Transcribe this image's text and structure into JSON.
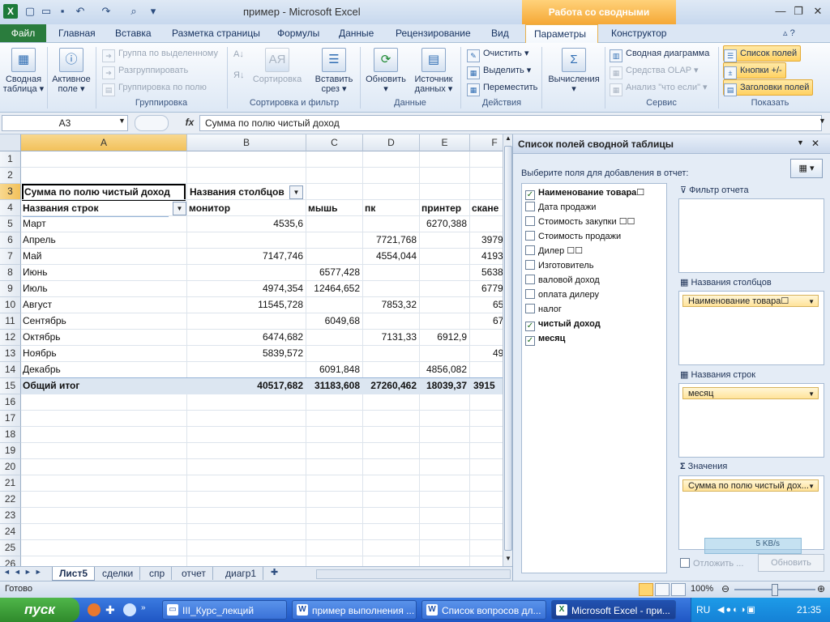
{
  "window": {
    "title": "пример  -  Microsoft Excel",
    "context_tab": "Работа со сводными таблицами",
    "app_icon": "X"
  },
  "tabs": [
    "Файл",
    "Главная",
    "Вставка",
    "Разметка страницы",
    "Формулы",
    "Данные",
    "Рецензирование",
    "Вид",
    "Параметры",
    "Конструктор"
  ],
  "ribbon": {
    "pivot_table": "Сводная\nтаблица ▾",
    "active_field": "Активное\nполе ▾",
    "group_selection": "Группа по выделенному",
    "ungroup": "Разгруппировать",
    "group_field": "Группировка по полю",
    "group_label": "Группировка",
    "sort": "Сортировка",
    "insert_slicer": "Вставить\nсрез ▾",
    "sort_label": "Сортировка и фильтр",
    "refresh": "Обновить\n▾",
    "data_source": "Источник\nданных ▾",
    "data_label": "Данные",
    "clear": "Очистить ▾",
    "select": "Выделить ▾",
    "move": "Переместить",
    "actions_label": "Действия",
    "calculations": "Вычисления\n▾",
    "pivot_chart": "Сводная диаграмма",
    "olap": "Средства OLAP ▾",
    "whatif": "Анализ \"что если\" ▾",
    "service_label": "Сервис",
    "field_list": "Список полей",
    "buttons": "Кнопки +/-",
    "headers": "Заголовки полей",
    "show_label": "Показать"
  },
  "formula_bar": {
    "name_box": "A3",
    "fx": "fx",
    "formula": "Сумма по полю чистый доход"
  },
  "grid": {
    "columns": [
      "A",
      "B",
      "C",
      "D",
      "E",
      "F"
    ],
    "rows": [
      "1",
      "2",
      "3",
      "4",
      "5",
      "6",
      "7",
      "8",
      "9",
      "10",
      "11",
      "12",
      "13",
      "14",
      "15",
      "16",
      "17",
      "18",
      "19",
      "20",
      "21",
      "22",
      "23",
      "24",
      "25",
      "26"
    ],
    "pivot_header": "Сумма по полю чистый доход",
    "col_labels": "Названия столбцов",
    "row_labels": "Названия строк",
    "categories": [
      "монитор",
      "мышь",
      "пк",
      "принтер",
      "скане"
    ],
    "data_rows": [
      {
        "label": "Март",
        "values": [
          "4535,6",
          "",
          "",
          "6270,388",
          ""
        ]
      },
      {
        "label": "Апрель",
        "values": [
          "",
          "",
          "7721,768",
          "",
          "3979"
        ]
      },
      {
        "label": "Май",
        "values": [
          "7147,746",
          "",
          "4554,044",
          "",
          "4193"
        ]
      },
      {
        "label": "Июнь",
        "values": [
          "",
          "6577,428",
          "",
          "",
          "5638"
        ]
      },
      {
        "label": "Июль",
        "values": [
          "4974,354",
          "12464,652",
          "",
          "",
          "6779"
        ]
      },
      {
        "label": "Август",
        "values": [
          "11545,728",
          "",
          "7853,32",
          "",
          "65"
        ]
      },
      {
        "label": "Сентябрь",
        "values": [
          "",
          "6049,68",
          "",
          "",
          "67"
        ]
      },
      {
        "label": "Октябрь",
        "values": [
          "6474,682",
          "",
          "7131,33",
          "6912,9",
          ""
        ]
      },
      {
        "label": "Ноябрь",
        "values": [
          "5839,572",
          "",
          "",
          "",
          "49"
        ]
      },
      {
        "label": "Декабрь",
        "values": [
          "",
          "6091,848",
          "",
          "4856,082",
          ""
        ]
      }
    ],
    "total_label": "Общий итог",
    "totals": [
      "40517,682",
      "31183,608",
      "27260,462",
      "18039,37",
      "3915"
    ]
  },
  "sheets": [
    "Лист5",
    "сделки",
    "спр",
    "отчет",
    "диагр1"
  ],
  "panel": {
    "title": "Список полей сводной таблицы",
    "subtitle": "Выберите поля для добавления в отчет:",
    "fields": [
      {
        "name": "Наименование товара☐",
        "checked": true
      },
      {
        "name": "Дата продажи",
        "checked": false
      },
      {
        "name": "Стоимость закупки ☐☐",
        "checked": false
      },
      {
        "name": "Стоимость продажи",
        "checked": false
      },
      {
        "name": "Дилер ☐☐",
        "checked": false
      },
      {
        "name": "Изготовитель",
        "checked": false
      },
      {
        "name": "валовой доход",
        "checked": false
      },
      {
        "name": "оплата дилеру",
        "checked": false
      },
      {
        "name": "налог",
        "checked": false
      },
      {
        "name": "чистый доход",
        "checked": true
      },
      {
        "name": "месяц",
        "checked": true
      }
    ],
    "report_filter": "Фильтр отчета",
    "column_labels": "Названия столбцов",
    "column_item": "Наименование товара☐",
    "row_labels": "Названия строк",
    "row_item": "месяц",
    "values_label": "Значения",
    "values_item": "Сумма по полю чистый дох...",
    "defer": "Отложить ...",
    "update": "Обновить",
    "speed": "5 KB/s"
  },
  "status": {
    "ready": "Готово",
    "zoom": "100%"
  },
  "taskbar": {
    "start": "пуск",
    "tasks": [
      "III_Курс_лекций",
      "пример выполнения ...",
      "Список вопросов дл...",
      "Microsoft Excel - при..."
    ],
    "lang": "RU",
    "time": "21:35"
  }
}
